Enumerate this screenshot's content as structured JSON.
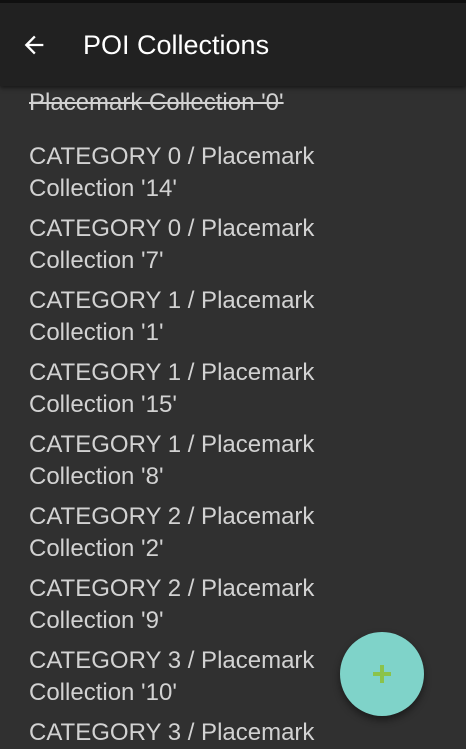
{
  "app_bar": {
    "title": "POI Collections",
    "back_icon": "arrow-left-icon",
    "background": "#212121"
  },
  "list": {
    "header_item": "Placemark Collection '0'",
    "items": [
      "CATEGORY 0 / Placemark Collection '14'",
      "CATEGORY 0 / Placemark Collection '7'",
      "CATEGORY 1 / Placemark Collection '1'",
      "CATEGORY 1 / Placemark Collection '15'",
      "CATEGORY 1 / Placemark Collection '8'",
      "CATEGORY 2 / Placemark Collection '2'",
      "CATEGORY 2 / Placemark Collection '9'",
      "CATEGORY 3 / Placemark Collection '10'",
      "CATEGORY 3 / Placemark"
    ]
  },
  "fab": {
    "icon": "plus-icon",
    "background": "#7fd3c9",
    "icon_color": "#8bc34a"
  }
}
